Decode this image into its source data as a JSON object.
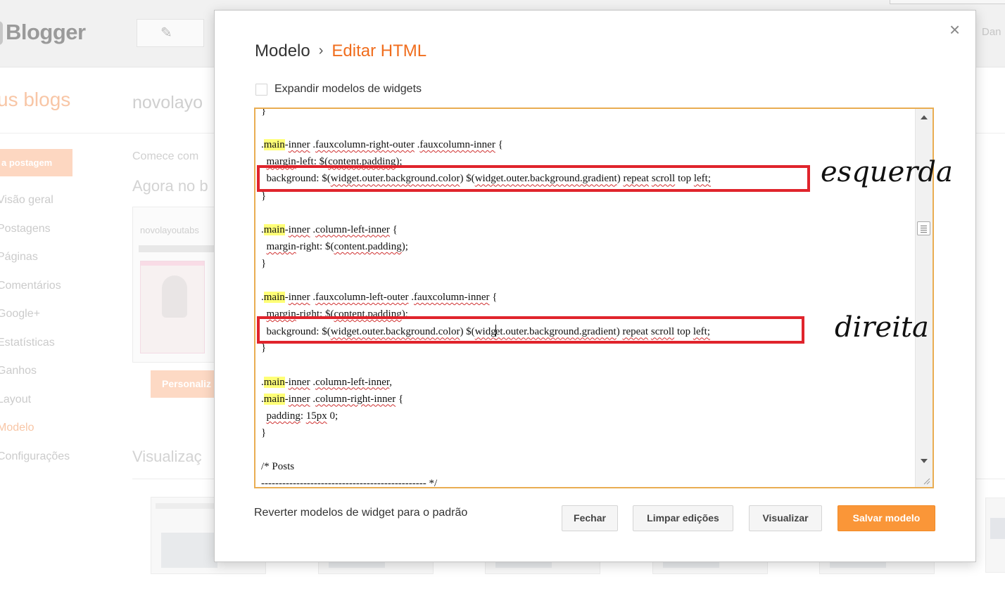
{
  "background": {
    "logo": "Blogger",
    "user_partial": "Dan",
    "my_blogs_partial": "us blogs",
    "blog_name_partial": "novolayo",
    "new_post_partial": "a postagem",
    "nav_items": [
      {
        "label": "Visão geral",
        "active": false
      },
      {
        "label": "Postagens",
        "active": false
      },
      {
        "label": "Páginas",
        "active": false
      },
      {
        "label": "Comentários",
        "active": false
      },
      {
        "label": "Google+",
        "active": false
      },
      {
        "label": "Estatísticas",
        "active": false
      },
      {
        "label": "Ganhos",
        "active": false
      },
      {
        "label": "Layout",
        "active": false
      },
      {
        "label": "Modelo",
        "active": true
      },
      {
        "label": "Configurações",
        "active": false
      }
    ],
    "start_partial": "Comece com",
    "now_partial": "Agora no b",
    "thumb_label_partial": "novolayoutabs",
    "customize_partial": "Personaliz",
    "preview_partial": "Visualizaç"
  },
  "modal": {
    "breadcrumb_parent": "Modelo",
    "breadcrumb_separator": "›",
    "breadcrumb_current": "Editar HTML",
    "close_icon": "×",
    "expand_widgets_label": "Expandir modelos de widgets",
    "expand_widgets_checked": false,
    "code_lines": [
      "}",
      "",
      ".main-inner .fauxcolumn-right-outer .fauxcolumn-inner {",
      "  margin-left: $(content.padding);",
      "  background: $(widget.outer.background.color) $(widget.outer.background.gradient) repeat scroll top left;",
      "}",
      "",
      ".main-inner .column-left-inner {",
      "  margin-right: $(content.padding);",
      "}",
      "",
      ".main-inner .fauxcolumn-left-outer .fauxcolumn-inner {",
      "  margin-right: $(content.padding);",
      "  background: $(widget.outer.background.color) $(widget.outer.background.gradient) repeat scroll top left;",
      "}",
      "",
      ".main-inner .column-left-inner,",
      ".main-inner .column-right-inner {",
      "  padding: 15px 0;",
      "}",
      "",
      "/* Posts",
      "----------------------------------------------- */"
    ],
    "revert_link": "Reverter modelos de widget para o padrão",
    "buttons": {
      "close": "Fechar",
      "clear": "Limpar edições",
      "preview": "Visualizar",
      "save": "Salvar modelo"
    }
  },
  "annotations": {
    "left_label": "esquerda",
    "right_label": "direita"
  },
  "colors": {
    "accent": "#f06d1d",
    "save_button": "#fa9638",
    "annotation_box": "#e0242c",
    "editor_border": "#e9ad52",
    "search_highlight": "#ffff77"
  }
}
